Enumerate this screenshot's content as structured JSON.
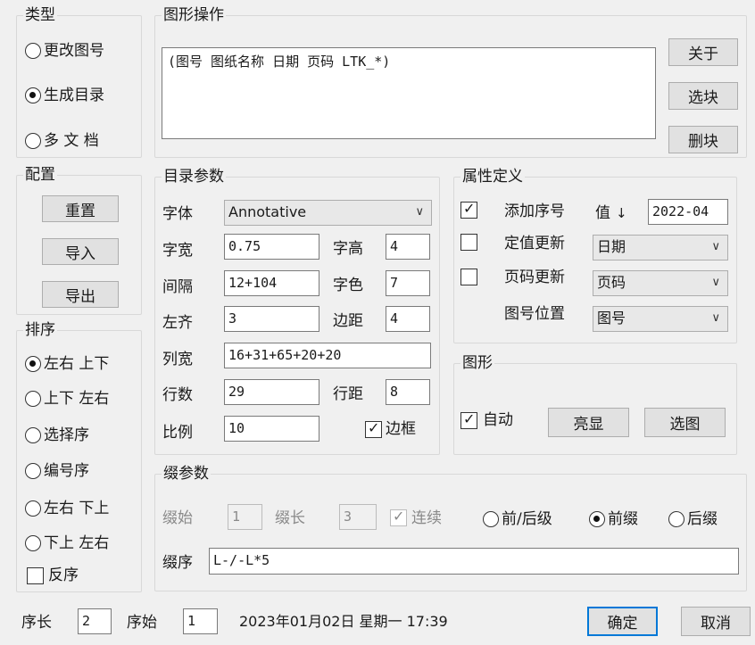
{
  "type_group": {
    "legend": "类型",
    "options": [
      "更改图号",
      "生成目录",
      "多 文 档"
    ],
    "selected": 1
  },
  "graphics_group": {
    "legend": "图形操作",
    "text": "(图号 图纸名称 日期 页码 LTK_*)",
    "buttons": [
      "关于",
      "选块",
      "删块"
    ]
  },
  "config_group": {
    "legend": "配置",
    "buttons": [
      "重置",
      "导入",
      "导出"
    ]
  },
  "sort_group": {
    "legend": "排序",
    "options": [
      "左右 上下",
      "上下 左右",
      "选择序",
      "编号序",
      "左右 下上",
      "下上 左右"
    ],
    "selected": 0,
    "reverse_label": "反序",
    "reverse_checked": false
  },
  "catalog_params": {
    "legend": "目录参数",
    "font_label": "字体",
    "font_value": "Annotative",
    "char_width_label": "字宽",
    "char_width_value": "0.75",
    "char_height_label": "字高",
    "char_height_value": "4",
    "spacing_label": "间隔",
    "spacing_value": "12+104",
    "char_color_label": "字色",
    "char_color_value": "7",
    "left_align_label": "左齐",
    "left_align_value": "3",
    "margin_label": "边距",
    "margin_value": "4",
    "col_width_label": "列宽",
    "col_width_value": "16+31+65+20+20",
    "rows_label": "行数",
    "rows_value": "29",
    "row_gap_label": "行距",
    "row_gap_value": "8",
    "scale_label": "比例",
    "scale_value": "10",
    "border_label": "边框",
    "border_checked": true
  },
  "attr_group": {
    "legend": "属性定义",
    "add_seq_label": "添加序号",
    "add_seq_checked": true,
    "value_label": "值",
    "value_arrow": "↓",
    "value_input": "2022-04",
    "fixed_update_label": "定值更新",
    "fixed_update_checked": false,
    "fixed_update_select": "日期",
    "page_update_label": "页码更新",
    "page_update_checked": false,
    "page_update_select": "页码",
    "drawing_no_pos_label": "图号位置",
    "drawing_no_pos_select": "图号"
  },
  "shape_group": {
    "legend": "图形",
    "auto_label": "自动",
    "auto_checked": true,
    "highlight_button": "亮显",
    "select_button": "选图"
  },
  "level_params": {
    "legend": "缀参数",
    "start_label": "缀始",
    "start_value": "1",
    "length_label": "缀长",
    "length_value": "3",
    "continuous_label": "连续",
    "continuous_checked": true,
    "affix_options": [
      "前/后级",
      "前缀",
      "后缀"
    ],
    "affix_selected": 1,
    "order_label": "缀序",
    "order_value": "L-/-L*5"
  },
  "footer": {
    "seq_len_label": "序长",
    "seq_len_value": "2",
    "seq_start_label": "序始",
    "seq_start_value": "1",
    "datetime": "2023年01月02日 星期一 17:39",
    "ok_button": "确定",
    "cancel_button": "取消"
  }
}
